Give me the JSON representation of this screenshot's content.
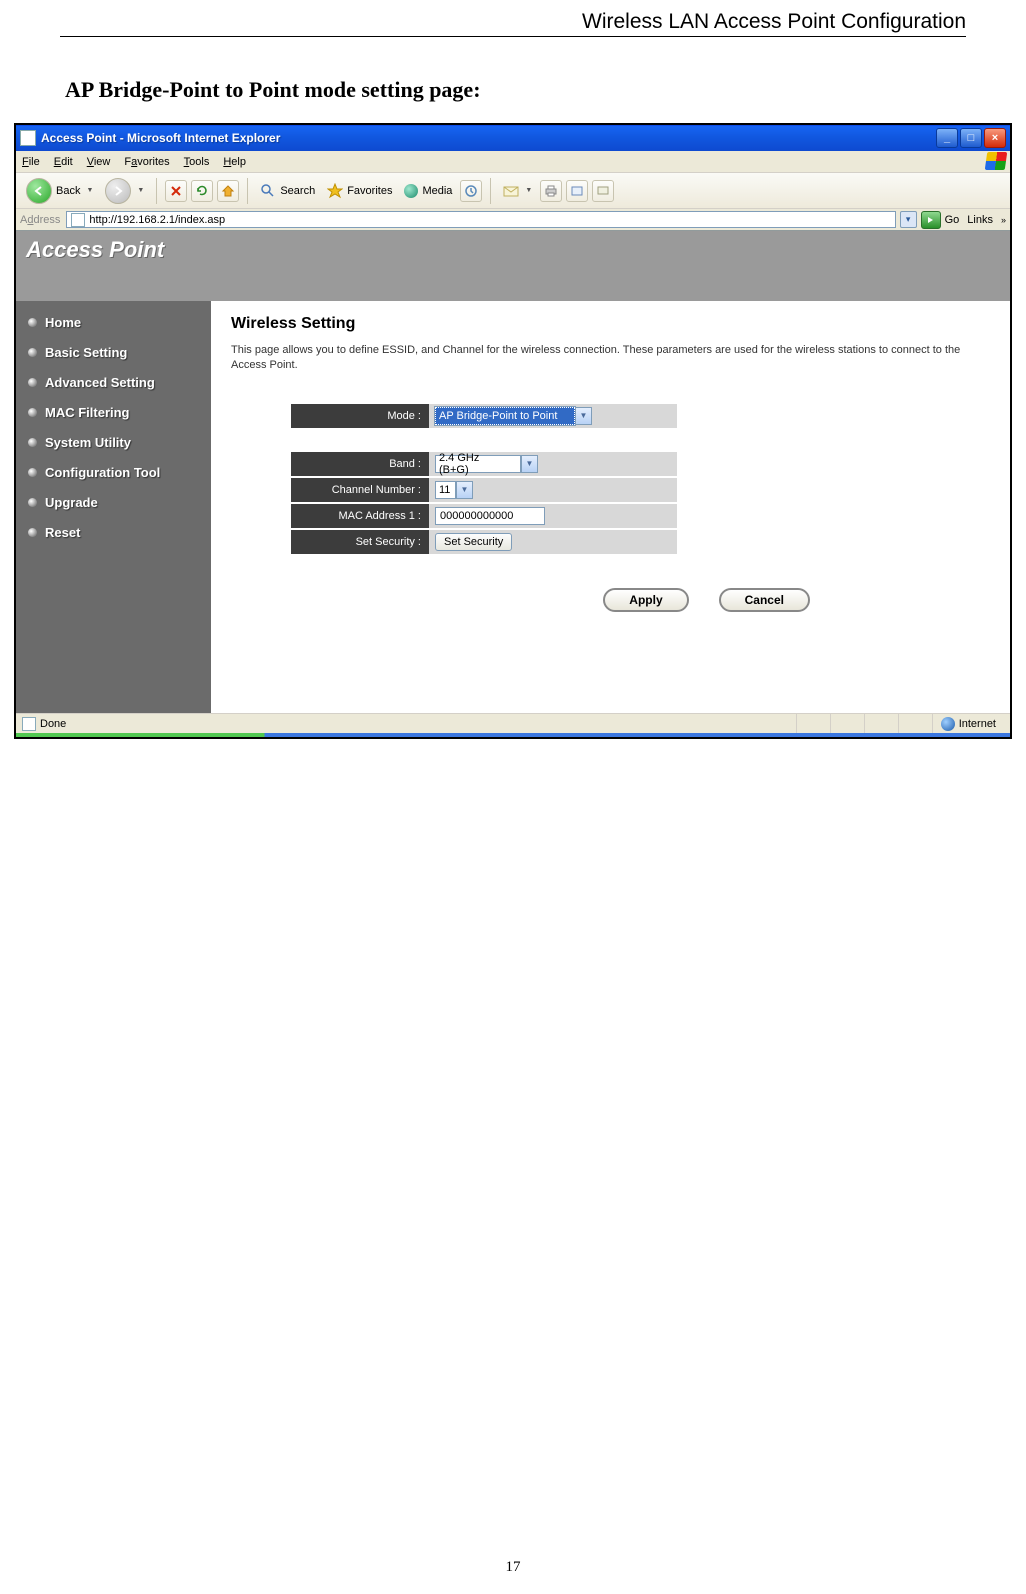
{
  "doc": {
    "header": "Wireless LAN Access Point Configuration",
    "section_title": "AP Bridge-Point to Point mode setting page:",
    "page_number": "17"
  },
  "window": {
    "title": "Access Point - Microsoft Internet Explorer",
    "min": "_",
    "max": "□",
    "close": "×"
  },
  "menubar": {
    "file": "File",
    "edit": "Edit",
    "view": "View",
    "favorites": "Favorites",
    "tools": "Tools",
    "help": "Help"
  },
  "toolbar": {
    "back": "Back",
    "search": "Search",
    "favorites": "Favorites",
    "media": "Media"
  },
  "addressbar": {
    "label": "Address",
    "url": "http://192.168.2.1/index.asp",
    "go": "Go",
    "links": "Links"
  },
  "ap": {
    "header": "Access Point",
    "nav": {
      "home": "Home",
      "basic": "Basic Setting",
      "advanced": "Advanced Setting",
      "mac": "MAC Filtering",
      "sysutil": "System Utility",
      "config": "Configuration Tool",
      "upgrade": "Upgrade",
      "reset": "Reset"
    },
    "panel": {
      "title": "Wireless Setting",
      "desc": "This page allows you to define ESSID, and Channel for the wireless connection. These parameters are used for the wireless stations to connect to the Access Point."
    },
    "form": {
      "mode_label": "Mode :",
      "mode_value": "AP Bridge-Point to Point",
      "band_label": "Band :",
      "band_value": "2.4 GHz (B+G)",
      "channel_label": "Channel Number :",
      "channel_value": "11",
      "mac_label": "MAC Address 1 :",
      "mac_value": "000000000000",
      "sec_label": "Set Security :",
      "sec_button": "Set Security"
    },
    "buttons": {
      "apply": "Apply",
      "cancel": "Cancel"
    }
  },
  "statusbar": {
    "done": "Done",
    "zone": "Internet"
  }
}
